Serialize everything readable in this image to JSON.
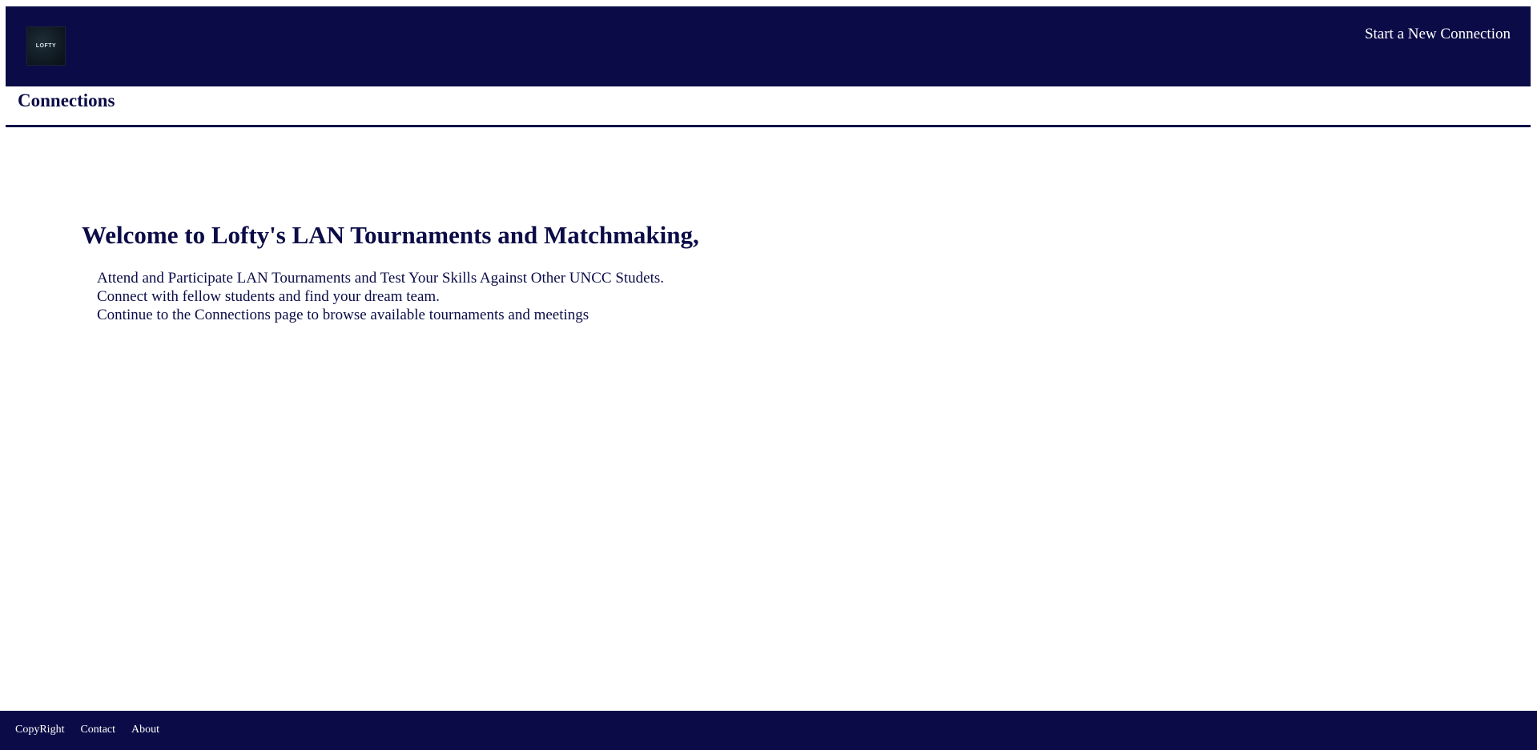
{
  "header": {
    "logo_text": "LOFTY",
    "new_connection_label": "Start a New Connection"
  },
  "subnav": {
    "connections_label": "Connections"
  },
  "main": {
    "welcome_heading": "Welcome to Lofty's LAN Tournaments and Matchmaking,",
    "lines": [
      "Attend and Participate LAN Tournaments and Test Your Skills Against Other UNCC Studets.",
      "Connect with fellow students and find your dream team.",
      "Continue to the Connections page to browse available tournaments and meetings"
    ]
  },
  "footer": {
    "links": [
      "CopyRight",
      "Contact",
      "About"
    ]
  },
  "colors": {
    "brand_navy": "#0b0c47",
    "background": "#ffffff",
    "footer_text": "#ffffff"
  }
}
